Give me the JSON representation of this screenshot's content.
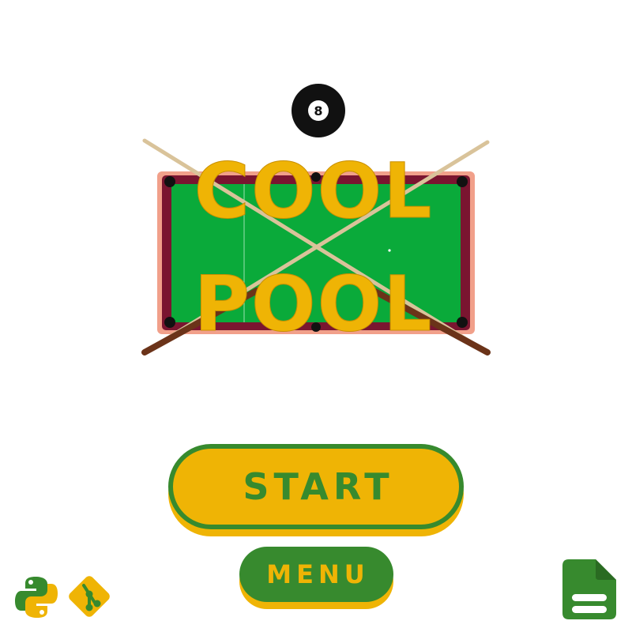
{
  "logo": {
    "word_top": "COOL",
    "word_bottom": "POOL",
    "ball_number": "8"
  },
  "buttons": {
    "start_label": "START",
    "menu_label": "MENU"
  },
  "icons": {
    "python": "python-icon",
    "git": "git-icon",
    "docs": "document-icon"
  },
  "colors": {
    "felt": "#0aaa3a",
    "rail": "#7a1530",
    "gold": "#efb405",
    "green": "#378a2e",
    "ball": "#111111"
  }
}
